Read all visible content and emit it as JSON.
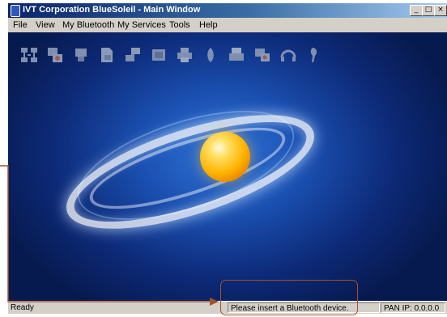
{
  "window": {
    "title": "IVT Corporation BlueSoleil - Main Window",
    "controls": [
      "_",
      "□",
      "×"
    ]
  },
  "menu": [
    "File",
    "View",
    "My Bluetooth",
    "My Services",
    "Tools",
    "Help"
  ],
  "toolbar": {
    "icons": [
      "network-icon",
      "dialup-icon",
      "lan-icon",
      "file-transfer-icon",
      "personal-area-network-icon",
      "image-icon",
      "printer-icon",
      "mouse-icon",
      "fax-icon",
      "sync-icon",
      "headset-icon",
      "audio-gateway-icon"
    ]
  },
  "status": {
    "ready": "Ready",
    "message": "Please insert a Bluetooth device.",
    "pan_ip": "PAN IP: 0.0.0.0"
  },
  "colors": {
    "callout": "#a0522d",
    "titlebar": "#0a246a"
  }
}
